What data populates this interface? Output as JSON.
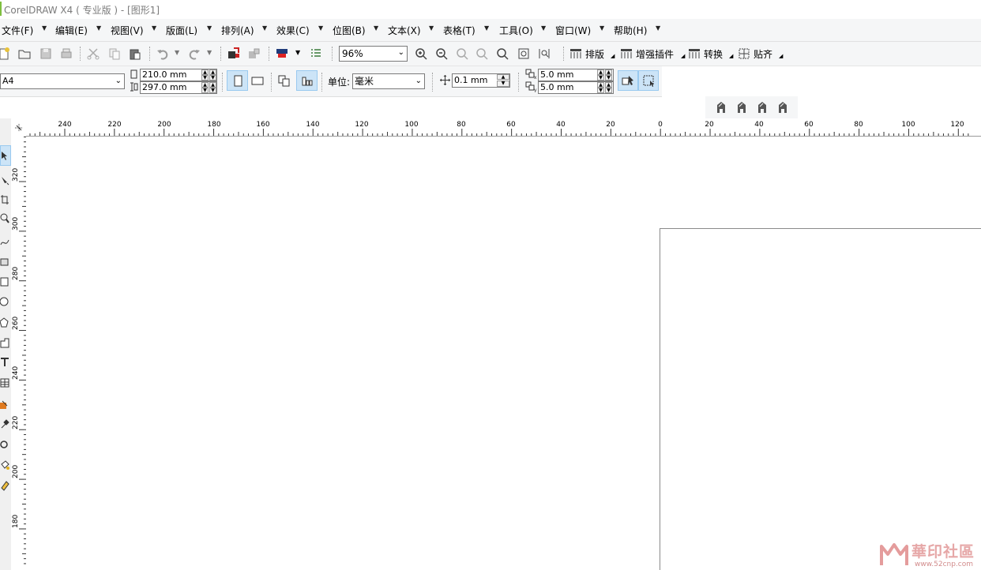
{
  "app": {
    "title": "CorelDRAW X4 ( 专业版 ) - [图形1]"
  },
  "menu": [
    {
      "label": "文件(F)"
    },
    {
      "label": "编辑(E)"
    },
    {
      "label": "视图(V)"
    },
    {
      "label": "版面(L)"
    },
    {
      "label": "排列(A)"
    },
    {
      "label": "效果(C)"
    },
    {
      "label": "位图(B)"
    },
    {
      "label": "文本(X)"
    },
    {
      "label": "表格(T)"
    },
    {
      "label": "工具(O)"
    },
    {
      "label": "窗口(W)"
    },
    {
      "label": "帮助(H)"
    }
  ],
  "toolbar": {
    "zoom_value": "96%",
    "layout_label": "排版",
    "plugins_label": "增强插件",
    "convert_label": "转换",
    "snap_label": "贴齐"
  },
  "propbar": {
    "paper_size": "A4",
    "page_width": "210.0 mm",
    "page_height": "297.0 mm",
    "unit_label": "单位:",
    "unit_value": "毫米",
    "nudge": "0.1 mm",
    "dup_x": "5.0 mm",
    "dup_y": "5.0 mm"
  },
  "ruler": {
    "h_labels": [
      "240",
      "220",
      "200",
      "180",
      "160",
      "140",
      "120",
      "100",
      "80",
      "60",
      "40",
      "20",
      "0",
      "20",
      "40",
      "60",
      "80",
      "100",
      "120"
    ],
    "v_labels": [
      "320",
      "300",
      "280",
      "260",
      "240",
      "220",
      "200",
      "180"
    ]
  },
  "watermark": {
    "text": "華印社區",
    "url": "www.52cnp.com"
  },
  "colors": {
    "accent_green": "#7fbf3f",
    "toggle_bg": "#cce4f7"
  }
}
